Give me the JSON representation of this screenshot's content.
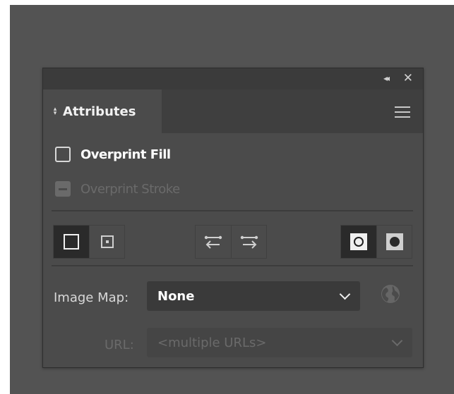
{
  "panel": {
    "title_controls": {
      "collapse_icon": "double-chevron-left-icon",
      "close_icon": "close-icon"
    },
    "tab": {
      "label": "Attributes",
      "arrows_icon": "up-down-arrows-icon"
    },
    "menu_icon": "hamburger-menu-icon",
    "overprint_fill": {
      "label": "Overprint Fill",
      "checked": false,
      "enabled": true
    },
    "overprint_stroke": {
      "label": "Overprint Stroke",
      "state": "mixed",
      "enabled": false
    },
    "toolbar": {
      "center_point_group": [
        "hide-center-point-icon",
        "show-center-point-icon"
      ],
      "direction_group": [
        "reverse-path-direction-off-icon",
        "reverse-path-direction-on-icon"
      ],
      "fill_rule_group": [
        "non-zero-winding-fill-rule-icon",
        "even-odd-fill-rule-icon"
      ]
    },
    "image_map": {
      "label": "Image Map:",
      "value": "None",
      "browser_icon": "globe-icon"
    },
    "url": {
      "label": "URL:",
      "value": "<multiple URLs>",
      "enabled": false
    }
  },
  "colors": {
    "canvas": "#535353",
    "panel": "#4b4b4b",
    "titlebar": "#3b3b3b",
    "selected_button": "#2a2a2a",
    "text": "#ffffff",
    "disabled_text": "#6a6a6a"
  }
}
